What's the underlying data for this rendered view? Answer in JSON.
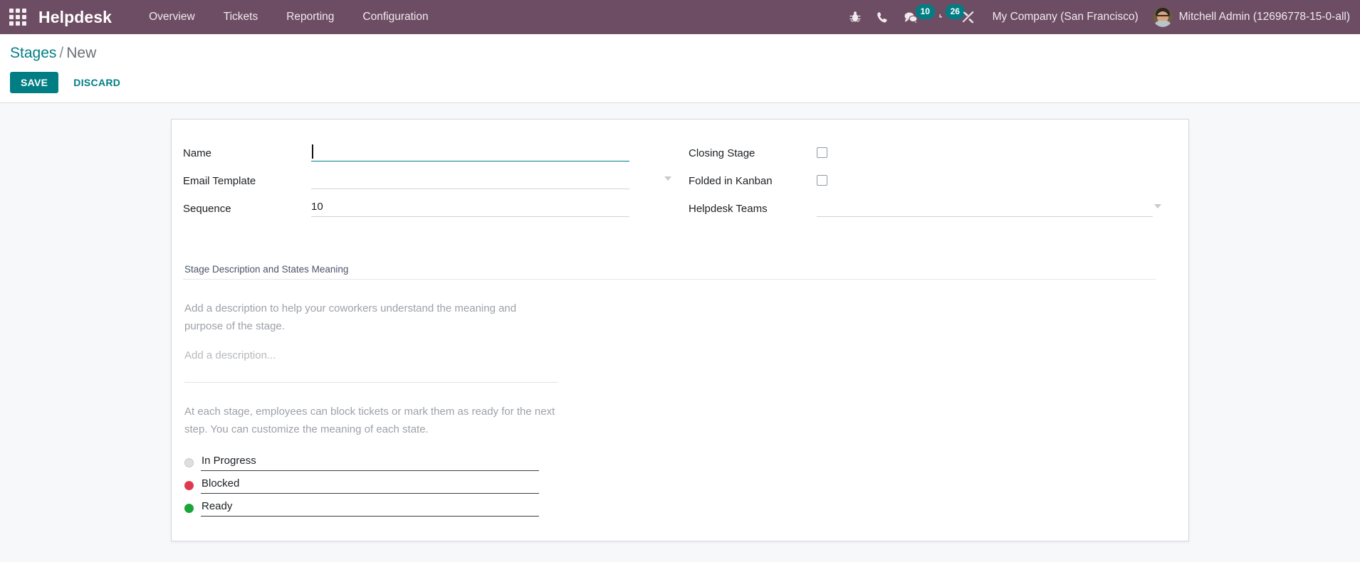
{
  "navbar": {
    "apps_icon": "apps-grid-icon",
    "brand": "Helpdesk",
    "menu_items": [
      {
        "label": "Overview"
      },
      {
        "label": "Tickets"
      },
      {
        "label": "Reporting"
      },
      {
        "label": "Configuration"
      }
    ],
    "icons": [
      {
        "name": "bug-icon",
        "badge": ""
      },
      {
        "name": "phone-icon",
        "badge": ""
      },
      {
        "name": "messages-icon",
        "badge": "10"
      },
      {
        "name": "activities-clock-icon",
        "badge": "26"
      },
      {
        "name": "tools-icon",
        "badge": ""
      }
    ],
    "company": "My Company (San Francisco)",
    "user": "Mitchell Admin (12696778-15-0-all)",
    "accent_bg": "#6d4d63",
    "badge_color": "#017e84"
  },
  "control_panel": {
    "breadcrumb_root": "Stages",
    "breadcrumb_sep": "/",
    "breadcrumb_current": "New",
    "save_label": "SAVE",
    "discard_label": "DISCARD",
    "primary_color": "#017e84"
  },
  "form": {
    "left": {
      "name_label": "Name",
      "name_value": "",
      "name_placeholder": "",
      "email_template_label": "Email Template",
      "email_template_value": "",
      "email_template_placeholder": "",
      "sequence_label": "Sequence",
      "sequence_value": "10"
    },
    "right": {
      "closing_stage_label": "Closing Stage",
      "closing_stage_checked": false,
      "folded_label": "Folded in Kanban",
      "folded_checked": false,
      "teams_label": "Helpdesk Teams",
      "teams_value": "",
      "teams_placeholder": ""
    },
    "section": {
      "title": "Stage Description and States Meaning",
      "description_help": "Add a description to help your coworkers understand the meaning and purpose of the stage.",
      "description_placeholder": "Add a description...",
      "states_help": "At each stage, employees can block tickets or mark them as ready for the next step. You can customize the meaning of each state.",
      "states": [
        {
          "label": "In Progress",
          "color": "#dcdee0",
          "dot": "grey"
        },
        {
          "label": "Blocked",
          "color": "#e0394f",
          "dot": "red"
        },
        {
          "label": "Ready",
          "color": "#1aa53b",
          "dot": "green"
        }
      ]
    }
  }
}
